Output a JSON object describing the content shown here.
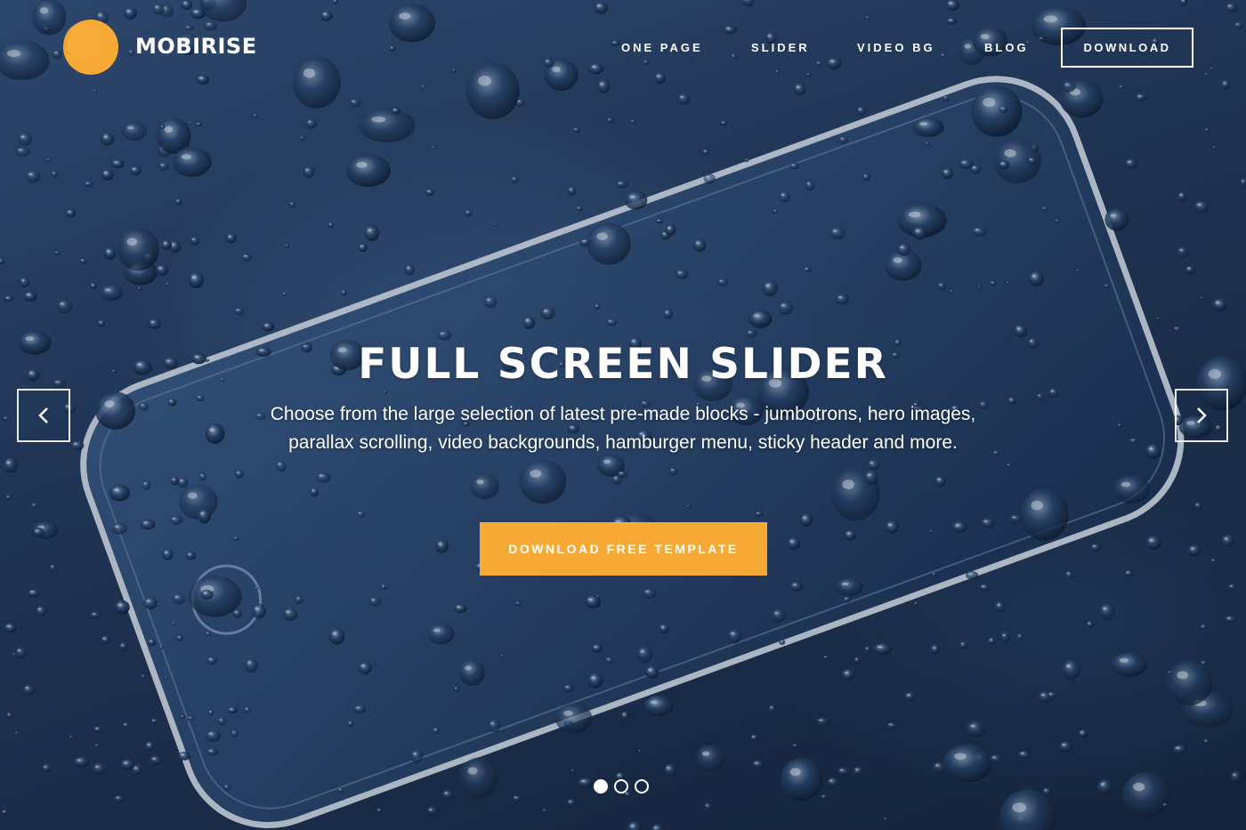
{
  "brand": {
    "name": "MOBIRISE",
    "logo_icon": "mobirise-logo-icon",
    "logo_color": "#f7a935"
  },
  "nav": {
    "items": [
      {
        "label": "ONE PAGE"
      },
      {
        "label": "SLIDER"
      },
      {
        "label": "VIDEO BG"
      },
      {
        "label": "BLOG"
      }
    ],
    "download_label": "DOWNLOAD"
  },
  "slide": {
    "title": "FULL SCREEN SLIDER",
    "subtitle": "Choose from the large selection of latest pre-made blocks - jumbotrons, hero images, parallax scrolling, video backgrounds, hamburger menu, sticky header and more.",
    "cta_label": "DOWNLOAD FREE TEMPLATE",
    "cta_color": "#f7a935",
    "background_image": "smartphone-with-water-drops"
  },
  "controls": {
    "prev_icon": "chevron-left-icon",
    "next_icon": "chevron-right-icon",
    "indicators": [
      {
        "active": true
      },
      {
        "active": false
      },
      {
        "active": false
      }
    ]
  }
}
